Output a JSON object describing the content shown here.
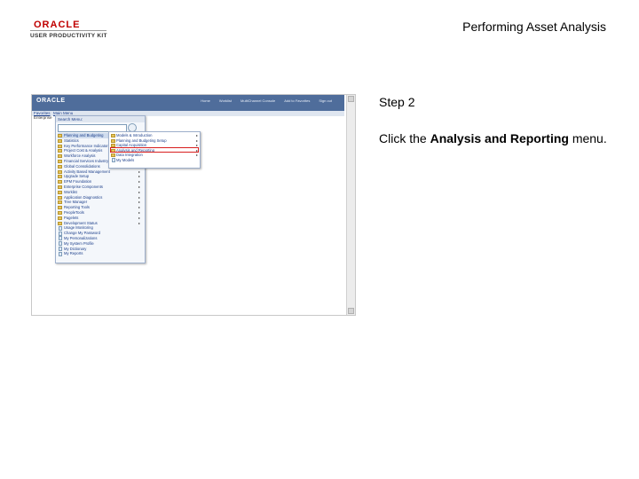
{
  "header": {
    "logo_text": "ORACLE",
    "logo_tagline": "USER PRODUCTIVITY KIT",
    "doc_title": "Performing Asset Analysis"
  },
  "step": {
    "label": "Step 2",
    "instruction_prefix": "Click the ",
    "instruction_target": "Analysis and Reporting",
    "instruction_suffix": " menu."
  },
  "screenshot": {
    "app_logo": "ORACLE",
    "top_nav": [
      "Home",
      "Worklist",
      "MultiChannel Console",
      "Add to Favorites",
      "Sign out"
    ],
    "breadcrumb": [
      "Favorites",
      "Main Menu"
    ],
    "header_label": "Enterprise",
    "menu_title": "Search Menu:",
    "menu_items": [
      {
        "label": "Planning and Budgeting",
        "icon": "folder",
        "arrow": false
      },
      {
        "label": "Statistics",
        "icon": "folder",
        "arrow": true
      },
      {
        "label": "Key Performance Indicators",
        "icon": "folder",
        "arrow": true
      },
      {
        "label": "Project Cost & Analysis",
        "icon": "folder",
        "arrow": true
      },
      {
        "label": "Workforce Analysis",
        "icon": "folder",
        "arrow": true
      },
      {
        "label": "Financial Services Industry",
        "icon": "folder",
        "arrow": true
      },
      {
        "label": "Global Consolidations",
        "icon": "folder",
        "arrow": true
      },
      {
        "label": "Activity Based Management",
        "icon": "folder",
        "arrow": true
      },
      {
        "label": "Upgrade Setup",
        "icon": "folder",
        "arrow": true
      },
      {
        "label": "EPM Foundation",
        "icon": "folder",
        "arrow": true
      },
      {
        "label": "Enterprise Components",
        "icon": "folder",
        "arrow": true
      },
      {
        "label": "Worklist",
        "icon": "folder",
        "arrow": true
      },
      {
        "label": "Application Diagnostics",
        "icon": "folder",
        "arrow": true
      },
      {
        "label": "Tree Manager",
        "icon": "folder",
        "arrow": true
      },
      {
        "label": "Reporting Tools",
        "icon": "folder",
        "arrow": true
      },
      {
        "label": "PeopleTools",
        "icon": "folder",
        "arrow": true
      },
      {
        "label": "Pagelets",
        "icon": "folder",
        "arrow": true
      },
      {
        "label": "Development Status",
        "icon": "folder",
        "arrow": true
      },
      {
        "label": "Usage Monitoring",
        "icon": "doc",
        "arrow": false
      },
      {
        "label": "Change My Password",
        "icon": "doc",
        "arrow": false
      },
      {
        "label": "My Personalizations",
        "icon": "doc",
        "arrow": false
      },
      {
        "label": "My System Profile",
        "icon": "doc",
        "arrow": false
      },
      {
        "label": "My Dictionary",
        "icon": "doc",
        "arrow": false
      },
      {
        "label": "My Reports",
        "icon": "doc",
        "arrow": false
      }
    ],
    "submenu_items": [
      {
        "label": "Models & Introduction",
        "icon": "folder",
        "arrow": true
      },
      {
        "label": "Planning and Budgeting Setup",
        "icon": "folder",
        "arrow": true
      },
      {
        "label": "Capital Acquisition",
        "icon": "folder",
        "arrow": true
      },
      {
        "label": "Analysis and Reporting",
        "icon": "folder",
        "arrow": true
      },
      {
        "label": "Data Integration",
        "icon": "folder",
        "arrow": true
      },
      {
        "label": "My Models",
        "icon": "doc",
        "arrow": false
      }
    ],
    "highlighted_index": 3
  }
}
